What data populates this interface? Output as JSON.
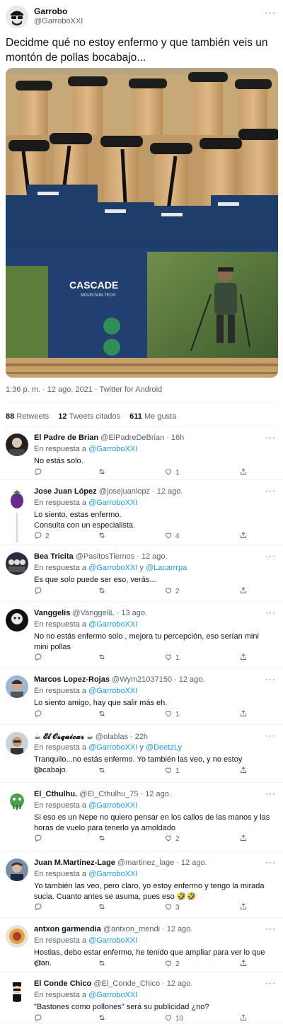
{
  "tweet": {
    "display_name": "Garrobo",
    "handle": "@GarroboXXI",
    "text": "Decidme qué no estoy enfermo y que también veis un montón de pollas bocabajo...",
    "photo_brand": "CASCADE",
    "photo_sub": "MOUNTAIN TECH",
    "timestamp": "1:36 p. m. · 12 ago. 2021 · Twitter for Android",
    "stats": {
      "retweets_count": "88",
      "retweets_label": "Retweets",
      "quotes_count": "12",
      "quotes_label": "Tweets citados",
      "likes_count": "611",
      "likes_label": "Me gusta"
    }
  },
  "replies": [
    {
      "name": "El Padre de Brian",
      "handle": "@ElPadreDeBrian",
      "time": "16h",
      "replying_to_label": "En respuesta a",
      "replying_to": "@GarroboXXI",
      "replying_to_2": "",
      "text": "No estás solo.",
      "replies": "",
      "retweets": "",
      "likes": "1"
    },
    {
      "name": "Jose Juan López",
      "handle": "@josejuanlopz",
      "time": "12 ago.",
      "replying_to_label": "En respuesta a",
      "replying_to": "@GarroboXXI",
      "replying_to_2": "",
      "text": "Lo siento, estas enfermo.\nConsulta con un especialista.",
      "replies": "2",
      "retweets": "",
      "likes": "4"
    },
    {
      "name": "Bea Tricita",
      "handle": "@PasitosTiernos",
      "time": "12 ago.",
      "replying_to_label": "En respuesta a",
      "replying_to": "@GarroboXXI",
      "replying_to_2": "@Lacarrrpa",
      "text": "Es que solo puede ser eso, verás...",
      "replies": "",
      "retweets": "",
      "likes": "2"
    },
    {
      "name": "Vanggelis",
      "handle": "@VanggeliL",
      "time": "13 ago.",
      "replying_to_label": "En respuesta a",
      "replying_to": "@GarroboXXI",
      "replying_to_2": "",
      "text": "No no estás enfermo solo , mejora tu percepción, eso serían mini mini pollas",
      "replies": "",
      "retweets": "",
      "likes": "1"
    },
    {
      "name": "Marcos Lopez-Rojas",
      "handle": "@Wym21037150",
      "time": "12 ago.",
      "replying_to_label": "En respuesta a",
      "replying_to": "@GarroboXXI",
      "replying_to_2": "",
      "text": "Lo siento amigo, hay que salir más eh.",
      "replies": "",
      "retweets": "",
      "likes": "1"
    },
    {
      "name": "☕ 𝓔𝓵 𝓞𝓼𝓺𝓾𝓲𝓬𝓪𝓻 ☕",
      "handle": "@olablas",
      "time": "22h",
      "replying_to_label": "En respuesta a",
      "replying_to": "@GarroboXXI",
      "replying_to_2": "@DeetzLy",
      "text": "Tranquilo...no estás enfermo. Yo también las veo, y no estoy bocabajo.",
      "replies": "",
      "retweets": "",
      "likes": "1"
    },
    {
      "name": "El_Cthulhu.",
      "handle": "@El_Cthulhu_75",
      "time": "12 ago.",
      "replying_to_label": "En respuesta a",
      "replying_to": "@GarroboXXI",
      "replying_to_2": "",
      "text": "Si eso es un Nepe no quiero pensar en los callos de las manos y las horas de vuelo para tenerlo ya amoldado",
      "replies": "",
      "retweets": "",
      "likes": "2"
    },
    {
      "name": "Juan M.Martinez-Lage",
      "handle": "@martinez_lage",
      "time": "12 ago.",
      "replying_to_label": "En respuesta a",
      "replying_to": "@GarroboXXI",
      "replying_to_2": "",
      "text": "Yo también las veo, pero claro, yo estoy enfermo y tengo la mirada sucia. Cuanto antes se asuma, pues eso 🤣🤣",
      "replies": "",
      "retweets": "",
      "likes": "3"
    },
    {
      "name": "antxon garmendia",
      "handle": "@antxon_mendi",
      "time": "12 ago.",
      "replying_to_label": "En respuesta a",
      "replying_to": "@GarroboXXI",
      "replying_to_2": "",
      "text": "Hostias, debo estar enfermo, he tenido que ampliar para ver lo que eran.",
      "replies": "",
      "retweets": "",
      "likes": "2"
    },
    {
      "name": "El Conde Chico",
      "handle": "@El_Conde_Chico",
      "time": "12 ago.",
      "replying_to_label": "En respuesta a",
      "replying_to": "@GarroboXXI",
      "replying_to_2": "",
      "text": "\"Bastones como pollones\" será su publicidad ¿no?",
      "replies": "",
      "retweets": "",
      "likes": "10"
    }
  ],
  "ui": {
    "and_label": "y",
    "more_glyph": "···",
    "separator": "·"
  },
  "colors": {
    "link": "#1d9bf0",
    "secondary": "#536471",
    "text": "#0f1419",
    "divider": "#eff3f4"
  }
}
